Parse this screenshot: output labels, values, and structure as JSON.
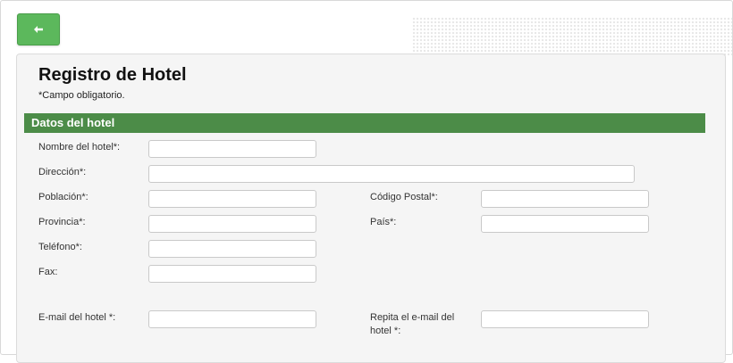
{
  "header": {
    "back_icon": "arrow-left-icon",
    "accent": "#5cb85c"
  },
  "form": {
    "title": "Registro de Hotel",
    "required_note": "*Campo obligatorio.",
    "section_title": "Datos del hotel",
    "section_color": "#4c8c48",
    "fields": {
      "hotel_name": {
        "label": "Nombre del hotel*:",
        "value": ""
      },
      "address": {
        "label": "Dirección*:",
        "value": ""
      },
      "town": {
        "label": "Población*:",
        "value": ""
      },
      "postal_code": {
        "label": "Código Postal*:",
        "value": ""
      },
      "province": {
        "label": "Provincia*:",
        "value": ""
      },
      "country": {
        "label": "País*:",
        "value": ""
      },
      "phone": {
        "label": "Teléfono*:",
        "value": ""
      },
      "fax": {
        "label": "Fax:",
        "value": ""
      },
      "email": {
        "label": "E-mail del hotel *:",
        "value": ""
      },
      "email_repeat": {
        "label_line1": "Repita el e-mail del",
        "label_line2": "hotel *:",
        "value": ""
      }
    }
  }
}
